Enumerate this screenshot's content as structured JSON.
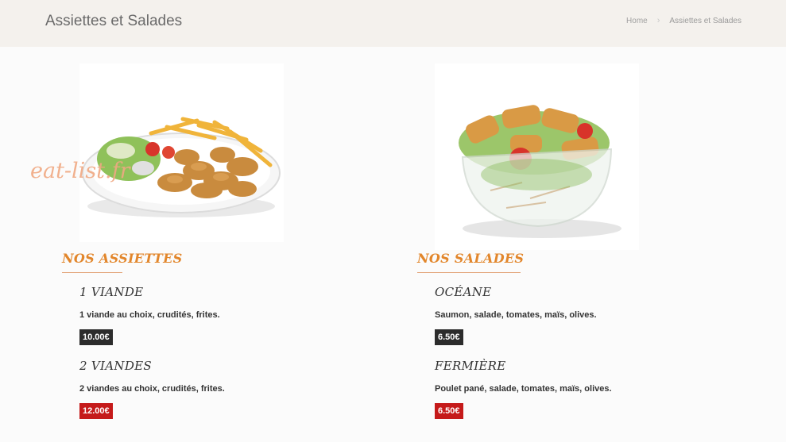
{
  "header": {
    "title": "Assiettes et Salades",
    "breadcrumb": {
      "home": "Home",
      "separator": "›",
      "current": "Assiettes et Salades"
    }
  },
  "watermark": "eat-list.fr",
  "sections": [
    {
      "heading": "NOS ASSIETTES",
      "image": "plate-of-meat-and-fries",
      "items": [
        {
          "name": "1 VIANDE",
          "description": "1 viande au choix, crudités, frites.",
          "price": "10.00€",
          "price_color": "#2c2c2c"
        },
        {
          "name": "2 VIANDES",
          "description": "2 viandes au choix, crudités, frites.",
          "price": "12.00€",
          "price_color": "#c51a1a"
        }
      ]
    },
    {
      "heading": "NOS SALADES",
      "image": "salad-bowl",
      "items": [
        {
          "name": "OCÉANE",
          "description": "Saumon, salade, tomates, maïs, olives.",
          "price": "6.50€",
          "price_color": "#2c2c2c"
        },
        {
          "name": "FERMIÈRE",
          "description": "Poulet pané, salade, tomates, maïs, olives.",
          "price": "6.50€",
          "price_color": "#c51a1a"
        }
      ]
    }
  ],
  "colors": {
    "accent": "#e2862b",
    "header_bg": "#f4f1ed",
    "price_dark": "#2c2c2c",
    "price_red": "#c51a1a"
  }
}
